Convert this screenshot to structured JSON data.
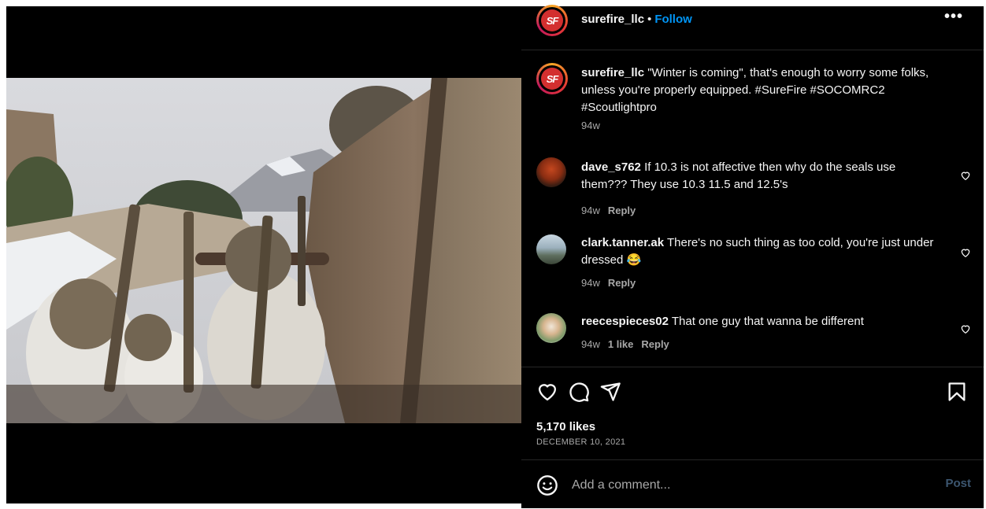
{
  "post": {
    "username": "surefire_llc",
    "follow_label": "Follow",
    "dot": "•",
    "more_label": "•••",
    "avatar_text": "SF",
    "caption_username": "surefire_llc",
    "caption_text": "\"Winter is coming\", that's enough to worry some folks, unless you're properly equipped. #SureFire #SOCOMRC2 #Scoutlightpro",
    "caption_time": "94w"
  },
  "comments": [
    {
      "username": "dave_s762",
      "text": "If 10.3 is not affective then why do the seals use them??? They use 10.3 11.5 and 12.5's",
      "time": "94w",
      "likes": "",
      "reply": "Reply"
    },
    {
      "username": "clark.tanner.ak",
      "text": "There's no such thing as too cold, you're just under dressed 😂",
      "time": "94w",
      "likes": "",
      "reply": "Reply"
    },
    {
      "username": "reecespieces02",
      "text": "That one guy that wanna be different",
      "time": "94w",
      "likes": "1 like",
      "reply": "Reply"
    }
  ],
  "stats": {
    "likes": "5,170 likes",
    "date": "DECEMBER 10, 2021"
  },
  "composer": {
    "placeholder": "Add a comment...",
    "post_label": "Post"
  },
  "icons": {
    "like": "heart-icon",
    "comment": "comment-icon",
    "share": "share-icon",
    "save": "bookmark-icon",
    "emoji": "emoji-icon",
    "more": "more-icon"
  },
  "colors": {
    "background": "#000000",
    "follow": "#0095f6",
    "muted": "#a8a8a8",
    "post_disabled": "#3c5670"
  }
}
